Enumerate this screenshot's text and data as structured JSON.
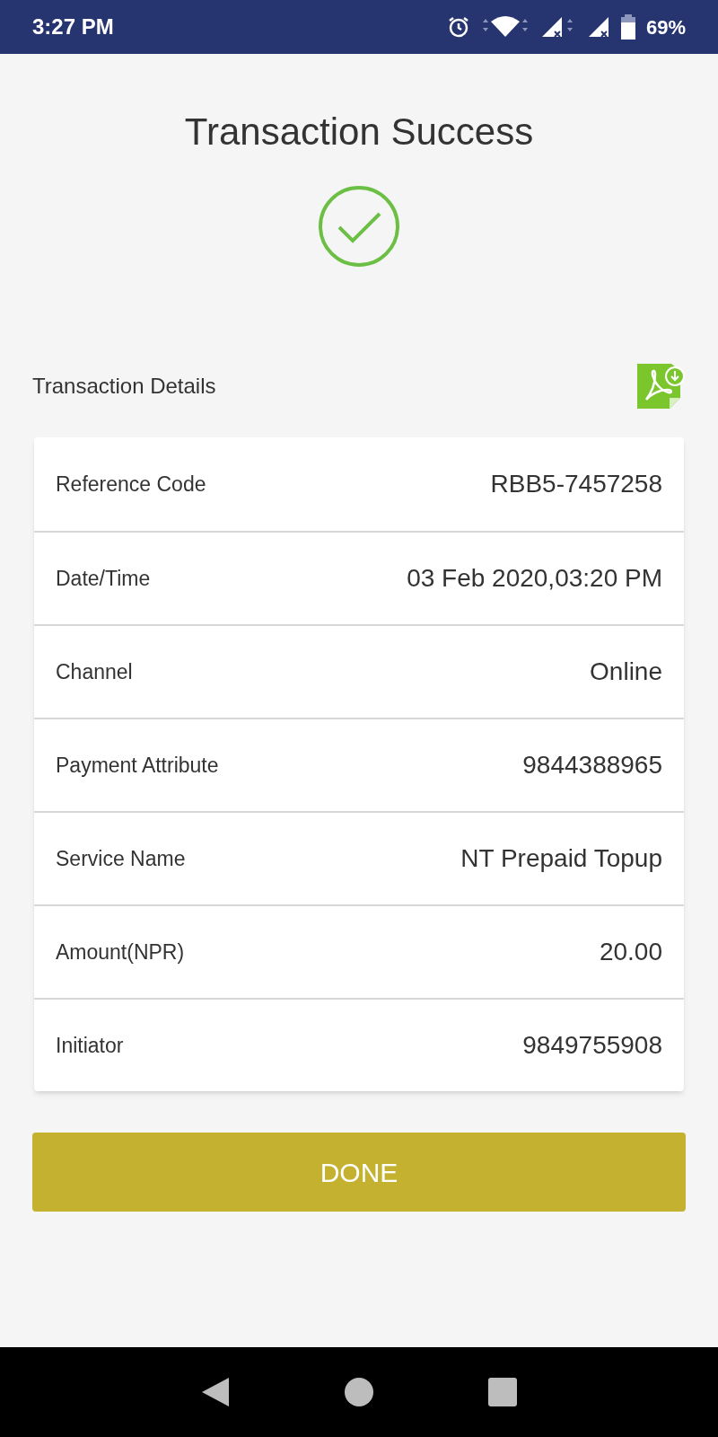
{
  "status_bar": {
    "time": "3:27 PM",
    "battery": "69%"
  },
  "title": "Transaction Success",
  "section_title": "Transaction Details",
  "details": [
    {
      "label": "Reference Code",
      "value": "RBB5-7457258"
    },
    {
      "label": "Date/Time",
      "value": "03 Feb 2020,03:20 PM"
    },
    {
      "label": "Channel",
      "value": "Online"
    },
    {
      "label": "Payment Attribute",
      "value": "9844388965"
    },
    {
      "label": "Service Name",
      "value": "NT Prepaid Topup"
    },
    {
      "label": "Amount(NPR)",
      "value": "20.00"
    },
    {
      "label": "Initiator",
      "value": "9849755908"
    }
  ],
  "done_button": "DONE"
}
